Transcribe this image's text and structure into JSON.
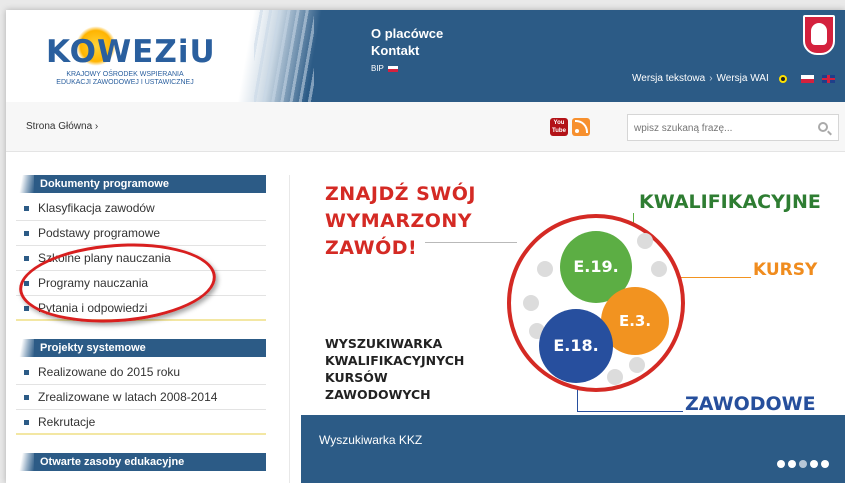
{
  "header": {
    "logo_text": "KOWEZiU",
    "logo_subtitle": "KRAJOWY OŚRODEK WSPIERANIA EDUKACJI ZAWODOWEJ I USTAWICZNEJ",
    "nav": [
      "O placówce",
      "Kontakt"
    ],
    "bip_label": "BIP",
    "lang": {
      "text_version": "Wersja tekstowa",
      "separator": "›",
      "wai_version": "Wersja WAI"
    }
  },
  "crumb_bar": {
    "breadcrumb": "Strona Główna  ›",
    "youtube_label": "You Tube",
    "search_placeholder": "wpisz szukaną frazę..."
  },
  "sidebar": {
    "sections": [
      {
        "title": "Dokumenty programowe",
        "items": [
          "Klasyfikacja zawodów",
          "Podstawy programowe",
          "Szkolne plany nauczania",
          "Programy nauczania",
          "Pytania i odpowiedzi"
        ]
      },
      {
        "title": "Projekty systemowe",
        "items": [
          "Realizowane do 2015 roku",
          "Zrealizowane w latach 2008-2014",
          "Rekrutacje"
        ]
      },
      {
        "title": "Otwarte zasoby edukacyjne",
        "items": []
      }
    ]
  },
  "banner": {
    "title_lines": [
      "ZNAJDŹ SWÓJ",
      "WYMARZONY",
      "ZAWÓD!"
    ],
    "subtitle_lines": [
      "WYSZUKIWARKA",
      "KWALIFIKACYJNYCH",
      "KURSÓW",
      "ZAWODOWYCH"
    ],
    "kwalifikacyjne": "KWALIFIKACYJNE",
    "kursy": "KURSY",
    "zawodowe": "ZAWODOWE",
    "discs": [
      "E.19.",
      "E.3.",
      "E.18."
    ],
    "caption": "Wyszukiwarka KKZ",
    "slide_dots": 5,
    "active_dot": 2
  },
  "colors": {
    "header_blue": "#2c5b86",
    "accent_red": "#d42a24",
    "green": "#5cae44",
    "orange": "#f29320",
    "blue": "#274f9e"
  }
}
